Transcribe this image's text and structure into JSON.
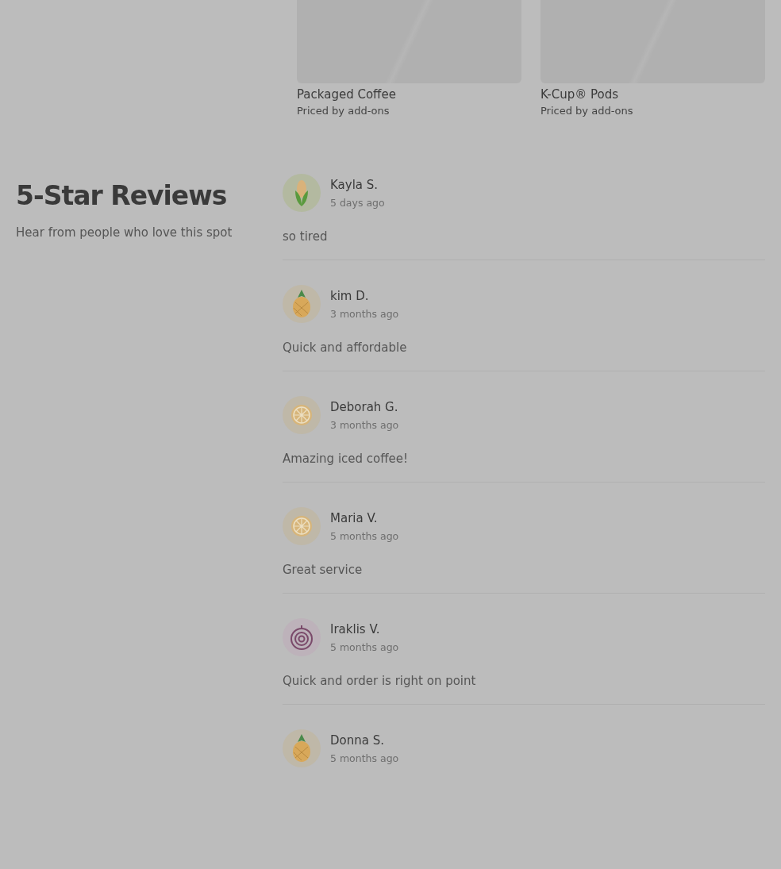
{
  "products": [
    {
      "name": "Packaged Coffee",
      "price": "Priced by add-ons"
    },
    {
      "name": "K-Cup® Pods",
      "price": "Priced by add-ons"
    }
  ],
  "reviews_section": {
    "title": "5-Star Reviews",
    "subtitle": "Hear from people who love this spot"
  },
  "reviews": [
    {
      "name": "Kayla S.",
      "time": "5 days ago",
      "text": "so tired",
      "kind": "corn"
    },
    {
      "name": "kim D.",
      "time": "3 months ago",
      "text": "Quick and affordable",
      "kind": "pineapple"
    },
    {
      "name": "Deborah G.",
      "time": "3 months ago",
      "text": "Amazing iced coffee!",
      "kind": "lemon"
    },
    {
      "name": "Maria V.",
      "time": "5 months ago",
      "text": "Great service",
      "kind": "lemon"
    },
    {
      "name": "Iraklis V.",
      "time": "5 months ago",
      "text": "Quick and order is right on point",
      "kind": "onion"
    },
    {
      "name": "Donna S.",
      "time": "5 months ago",
      "kind": "pineapple"
    }
  ]
}
